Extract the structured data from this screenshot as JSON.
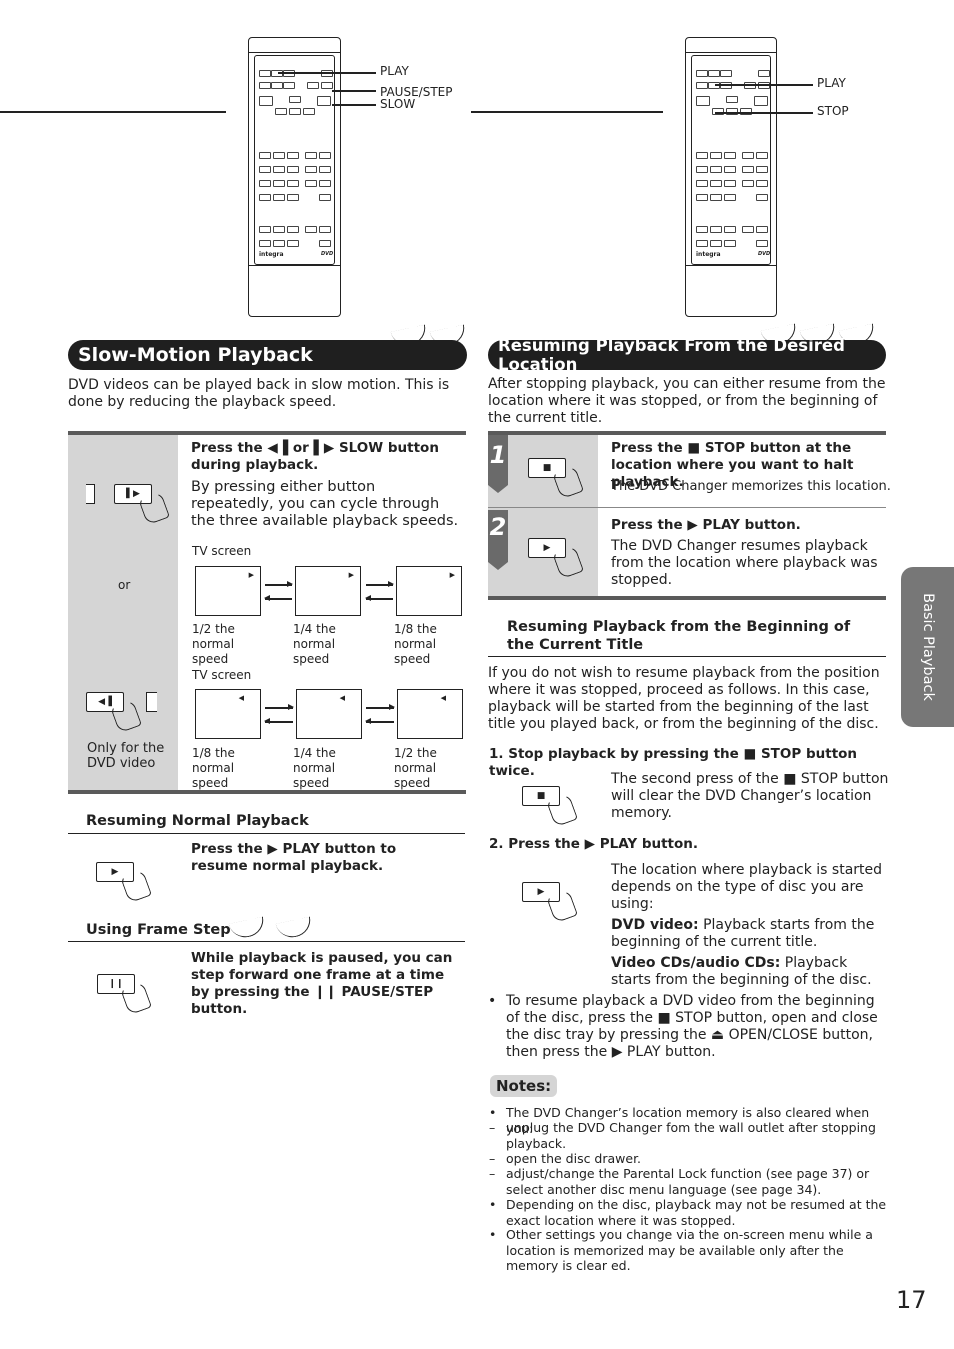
{
  "remotes": {
    "left": {
      "brand": "integra",
      "disc_logo": "DVD",
      "callouts": [
        "PLAY",
        "PAUSE/STEP",
        "SLOW"
      ]
    },
    "right": {
      "brand": "integra",
      "disc_logo": "DVD",
      "callouts": [
        "PLAY",
        "STOP"
      ]
    }
  },
  "slow_motion": {
    "title": "Slow-Motion Playback",
    "intro": "DVD videos can be played back in slow motion. This is done by reducing the playback speed.",
    "instruction_bold": "Press the ◀▐ or ▌▶ SLOW button during playback.",
    "instruction_body": "By pressing either button repeatedly, you can cycle through the three available playback speeds.",
    "or_label": "or",
    "only_dvd_label": "Only for the DVD video",
    "forward": {
      "tv_label": "TV screen",
      "marker": "▶",
      "captions": [
        "1/2 the normal speed",
        "1/4 the normal speed",
        "1/8 the normal speed"
      ]
    },
    "reverse": {
      "tv_label": "TV screen",
      "marker": "◀",
      "captions": [
        "1/8 the normal speed",
        "1/4 the normal speed",
        "1/2 the normal speed"
      ]
    },
    "button_icons": {
      "forward": "▌▶",
      "reverse": "◀▐"
    }
  },
  "resuming_normal": {
    "title": "Resuming Normal Playback",
    "text": "Press the ▶ PLAY button to resume normal playback.",
    "button_icon": "▶"
  },
  "frame_step": {
    "title": "Using Frame Step",
    "text": "While playback is paused, you can step forward one frame at a time by pressing the ❙❙ PAUSE/STEP button.",
    "button_icon": "❙❙"
  },
  "resume_location": {
    "title": "Resuming Playback From the Desired Location",
    "intro": "After stopping playback, you can either resume from the location where it was stopped, or from the beginning of the current title.",
    "steps": [
      {
        "num": "1",
        "bold": "Press the ■ STOP button at the location where you want to halt playback.",
        "body": "The DVD Changer memorizes this location.",
        "button_icon": "■"
      },
      {
        "num": "2",
        "bold": "Press the ▶ PLAY button.",
        "body": "The DVD Changer resumes playback from the location where playback was stopped.",
        "button_icon": "▶"
      }
    ]
  },
  "beginning": {
    "title": "Resuming Playback from the Beginning of the Current Title",
    "intro": "If you do not wish to resume playback from the position where it was stopped, proceed as follows. In this case, playback will be started from the beginning of the last title you played back, or from the beginning of the disc.",
    "step1": {
      "label": "1. Stop playback by pressing the ■ STOP button twice.",
      "body": "The second press of the ■ STOP button will clear the DVD Changer’s location memory.",
      "button_icon": "■"
    },
    "step2": {
      "label": "2. Press the ▶ PLAY button.",
      "body": "The location where playback is started depends on the type of disc you are using:",
      "button_icon": "▶",
      "dvd_label": "DVD video:",
      "dvd_text": "Playback starts from the beginning of the current title.",
      "vcd_label": "Video CDs/audio CDs:",
      "vcd_text": "Playback starts from the beginning of the disc."
    },
    "bullet": "To resume playback a DVD video from the beginning of the disc, press the ■ STOP button, open and close the disc tray by pressing the ⏏ OPEN/CLOSE button, then press the ▶ PLAY button."
  },
  "notes": {
    "title": "Notes:",
    "items": [
      {
        "mark": "•",
        "text": "The DVD Changer’s location memory is also cleared when you:"
      },
      {
        "mark": "–",
        "text": "unplug the DVD Changer fom the wall outlet after stopping playback."
      },
      {
        "mark": "–",
        "text": "open the disc drawer."
      },
      {
        "mark": "–",
        "text": "adjust/change the Parental Lock function (see page 37) or select another disc menu language (see page 34)."
      },
      {
        "mark": "•",
        "text": "Depending on the disc, playback may not be resumed at the exact location where it was stopped."
      },
      {
        "mark": "•",
        "text": "Other settings you change via the on-screen menu while a location is memorized may be available only after the memory is clear ed."
      }
    ]
  },
  "side_tab": "Basic Playback",
  "page_number": "17"
}
